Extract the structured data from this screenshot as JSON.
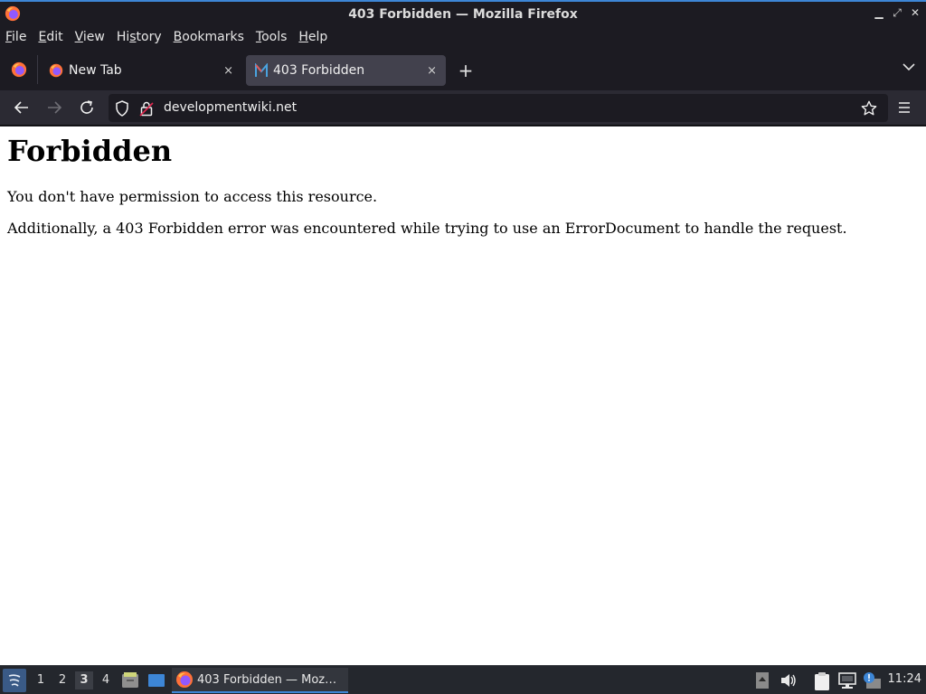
{
  "window": {
    "title": "403 Forbidden — Mozilla Firefox"
  },
  "menu": [
    {
      "label": "File",
      "key": "F",
      "rest": "ile"
    },
    {
      "label": "Edit",
      "key": "E",
      "rest": "dit"
    },
    {
      "label": "View",
      "key": "V",
      "rest": "iew"
    },
    {
      "label": "History",
      "pre": "Hi",
      "key": "s",
      "rest": "tory"
    },
    {
      "label": "Bookmarks",
      "key": "B",
      "rest": "ookmarks"
    },
    {
      "label": "Tools",
      "key": "T",
      "rest": "ools"
    },
    {
      "label": "Help",
      "key": "H",
      "rest": "elp"
    }
  ],
  "tabs": [
    {
      "title": "New Tab",
      "active": false,
      "close": "×"
    },
    {
      "title": "403 Forbidden",
      "active": true,
      "close": "×"
    }
  ],
  "toolbar": {
    "new_tab": "+"
  },
  "urlbar": {
    "value": "developmentwiki.net"
  },
  "page": {
    "heading": "Forbidden",
    "paragraph1": "You don't have permission to access this resource.",
    "paragraph2": "Additionally, a 403 Forbidden error was encountered while trying to use an ErrorDocument to handle the request."
  },
  "taskbar": {
    "workspaces": [
      "1",
      "2",
      "3",
      "4"
    ],
    "active_workspace": "3",
    "task_label": "403 Forbidden — Moz…",
    "clock": "11:24"
  },
  "colors": {
    "accent": "#3d86d6",
    "firefox_orange": "#ff7139",
    "firefox_purple": "#9059ff"
  }
}
